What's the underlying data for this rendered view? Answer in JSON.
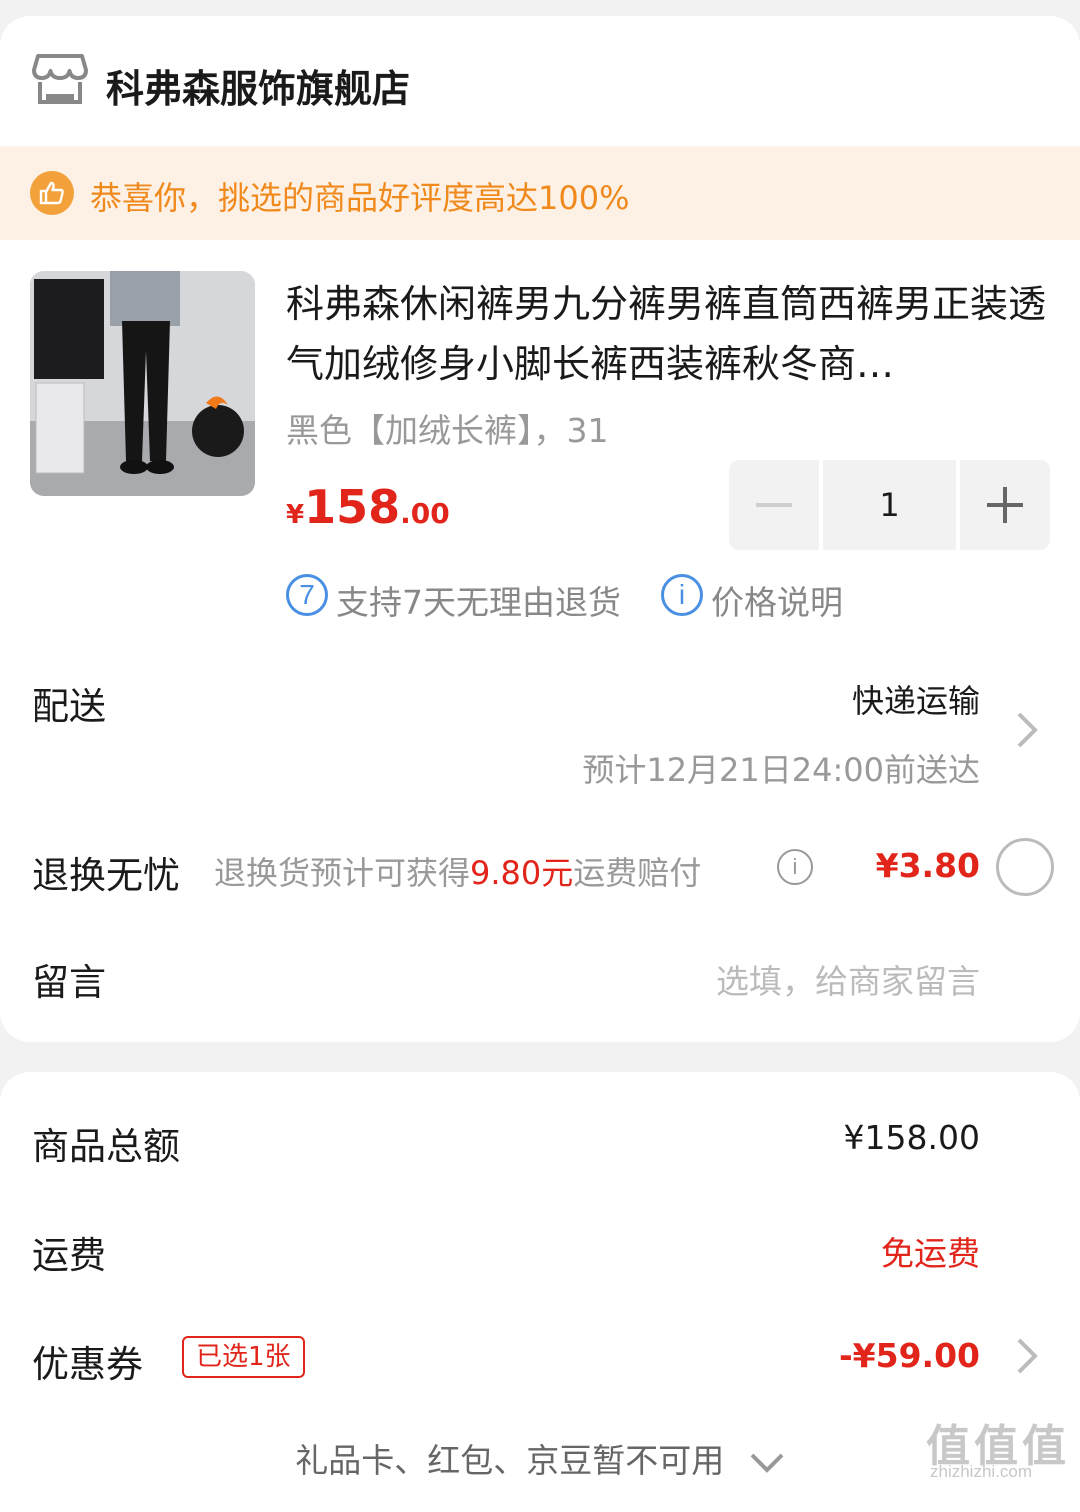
{
  "store": {
    "name": "科弗森服饰旗舰店"
  },
  "banner": {
    "text": "恭喜你，挑选的商品好评度高达100%"
  },
  "product": {
    "title": "科弗森休闲裤男九分裤男裤直筒西裤男正装透气加绒修身小脚长裤西装裤秋冬商…",
    "spec": "黑色【加绒长裤】，31",
    "price_currency": "¥",
    "price_int": "158",
    "price_dec": ".00",
    "quantity": "1",
    "services": [
      {
        "icon": "7",
        "text": "支持7天无理由退货"
      },
      {
        "icon": "i",
        "text": "价格说明"
      }
    ]
  },
  "delivery": {
    "label": "配送",
    "method": "快递运输",
    "eta": "预计12月21日24:00前送达"
  },
  "return_protect": {
    "label": "退换无忧",
    "desc_prefix": "退换货预计可获得",
    "desc_highlight": "9.80元",
    "desc_suffix": "运费赔付",
    "price": "¥3.80"
  },
  "message": {
    "label": "留言",
    "placeholder": "选填，给商家留言"
  },
  "summary": {
    "goods_total_label": "商品总额",
    "goods_total_value": "¥158.00",
    "shipping_label": "运费",
    "shipping_value": "免运费",
    "coupon_label": "优惠券",
    "coupon_badge": "已选1张",
    "coupon_value": "-¥59.00",
    "unavailable_text": "礼品卡、红包、京豆暂不可用"
  },
  "watermark": {
    "main": "值值值",
    "sub": "zhizhizhi.com"
  },
  "colors": {
    "accent_red": "#e1251b",
    "banner_orange": "#f08a1d",
    "banner_bg": "#fdf1e6",
    "service_blue": "#4a90e2"
  }
}
